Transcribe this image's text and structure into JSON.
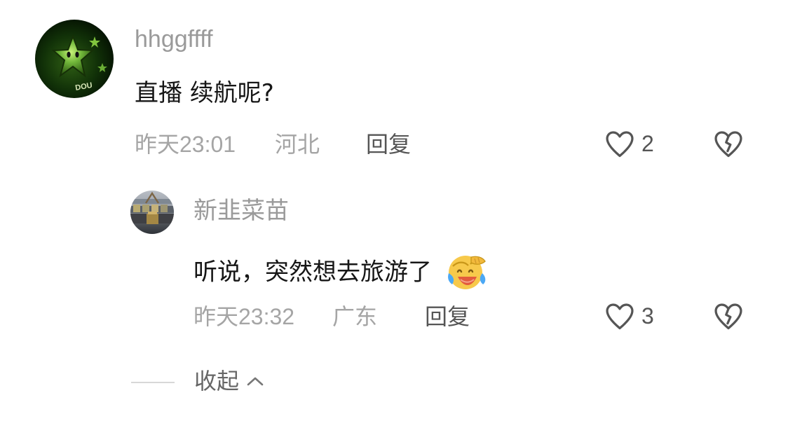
{
  "comments": [
    {
      "username": "hhggffff",
      "text": "直播 续航呢?",
      "time": "昨天23:01",
      "location": "河北",
      "reply_label": "回复",
      "likes": "2",
      "avatar_icon": "green-star-avatar",
      "avatar_badge": "DOU"
    },
    {
      "username": "新韭菜苗",
      "text": "听说，突然想去旅游了",
      "emoji": "laughing-crying-emoji",
      "time": "昨天23:32",
      "location": "广东",
      "reply_label": "回复",
      "likes": "3",
      "avatar_icon": "stadium-photo-avatar"
    }
  ],
  "collapse": {
    "label": "收起"
  },
  "colors": {
    "text_primary": "#161616",
    "text_secondary": "#a5a5a5",
    "action_text": "#555555",
    "icon_outline": "#555555",
    "emoji_face": "#f7c94b",
    "emoji_tears": "#4ba8f5",
    "emoji_mouth": "#e35b3d"
  }
}
